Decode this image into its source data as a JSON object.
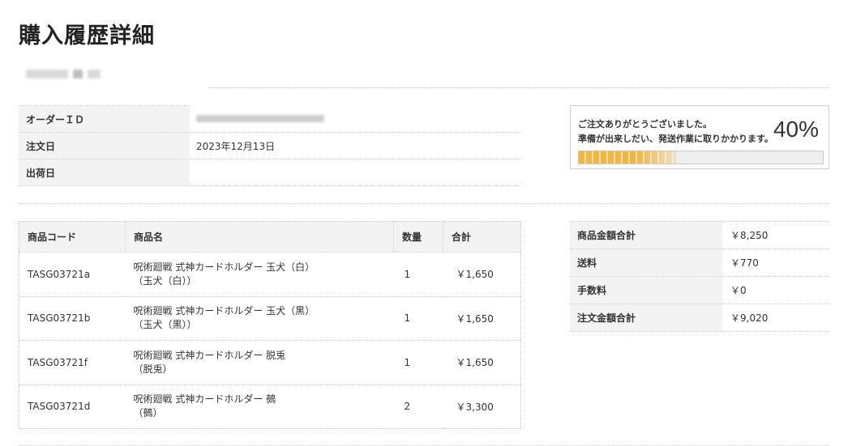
{
  "page": {
    "title": "購入履歴詳細"
  },
  "order_info": {
    "rows": [
      {
        "label": "オーダーＩＤ",
        "value": ""
      },
      {
        "label": "注文日",
        "value": "2023年12月13日"
      },
      {
        "label": "出荷日",
        "value": ""
      }
    ]
  },
  "progress": {
    "message_line1": "ご注文ありがとうございました。",
    "message_line2": "準備が出来しだい、発送作業に取りかかります。",
    "percent_text": "40%",
    "percent": 40,
    "fill_color": "#f2b540"
  },
  "products": {
    "headers": {
      "code": "商品コード",
      "name": "商品名",
      "qty": "数量",
      "total": "合計"
    },
    "rows": [
      {
        "code": "TASG03721a",
        "name1": "呪術廻戦 式神カードホルダー 玉犬（白）",
        "name2": "（玉犬（白））",
        "qty": "1",
        "total": "￥1,650"
      },
      {
        "code": "TASG03721b",
        "name1": "呪術廻戦 式神カードホルダー 玉犬（黒）",
        "name2": "（玉犬（黒））",
        "qty": "1",
        "total": "￥1,650"
      },
      {
        "code": "TASG03721f",
        "name1": "呪術廻戦 式神カードホルダー 脱兎",
        "name2": "（脱兎）",
        "qty": "1",
        "total": "￥1,650"
      },
      {
        "code": "TASG03721d",
        "name1": "呪術廻戦 式神カードホルダー 鵺",
        "name2": "（鵺）",
        "qty": "2",
        "total": "￥3,300"
      }
    ]
  },
  "summary": {
    "rows": [
      {
        "label": "商品金額合計",
        "value": "￥8,250"
      },
      {
        "label": "送料",
        "value": "￥770"
      },
      {
        "label": "手数料",
        "value": "￥0"
      },
      {
        "label": "注文金額合計",
        "value": "￥9,020"
      }
    ]
  }
}
